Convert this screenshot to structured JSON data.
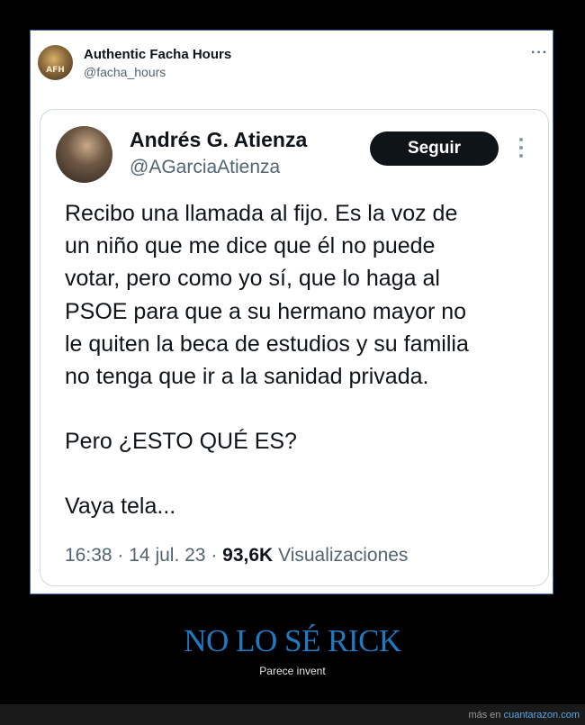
{
  "outer_tweet": {
    "avatar_label": "AFH",
    "name": "Authentic Facha Hours",
    "handle": "@facha_hours",
    "more_icon": "more-horizontal-icon",
    "more_glyph": "···"
  },
  "quoted_tweet": {
    "name": "Andrés G. Atienza",
    "handle": "@AGarciaAtienza",
    "follow_label": "Seguir",
    "more_icon": "more-vertical-icon",
    "text_lines": [
      "Recibo una llamada al fijo. Es la voz de",
      "un niño que me dice que él no puede",
      "votar, pero como yo sí, que lo haga al",
      "PSOE para que a su hermano mayor no",
      "le quiten la beca de estudios y su familia",
      "no tenga que ir a la sanidad privada.",
      "Pero ¿ESTO QUÉ ES?",
      "Vaya tela..."
    ],
    "time": "16:38",
    "date": "14 jul. 23",
    "views_count": "93,6K",
    "views_label": "Visualizaciones",
    "separator": "·"
  },
  "caption": {
    "title": "NO LO SÉ RICK",
    "subtitle": "Parece invent"
  },
  "footer": {
    "prefix": "más en",
    "site": "cuantarazon.com"
  },
  "colors": {
    "frame_border": "#4a6fa8",
    "caption_title": "#1f7ac4",
    "link": "#5aa6e6",
    "button_bg": "#0f1419"
  }
}
